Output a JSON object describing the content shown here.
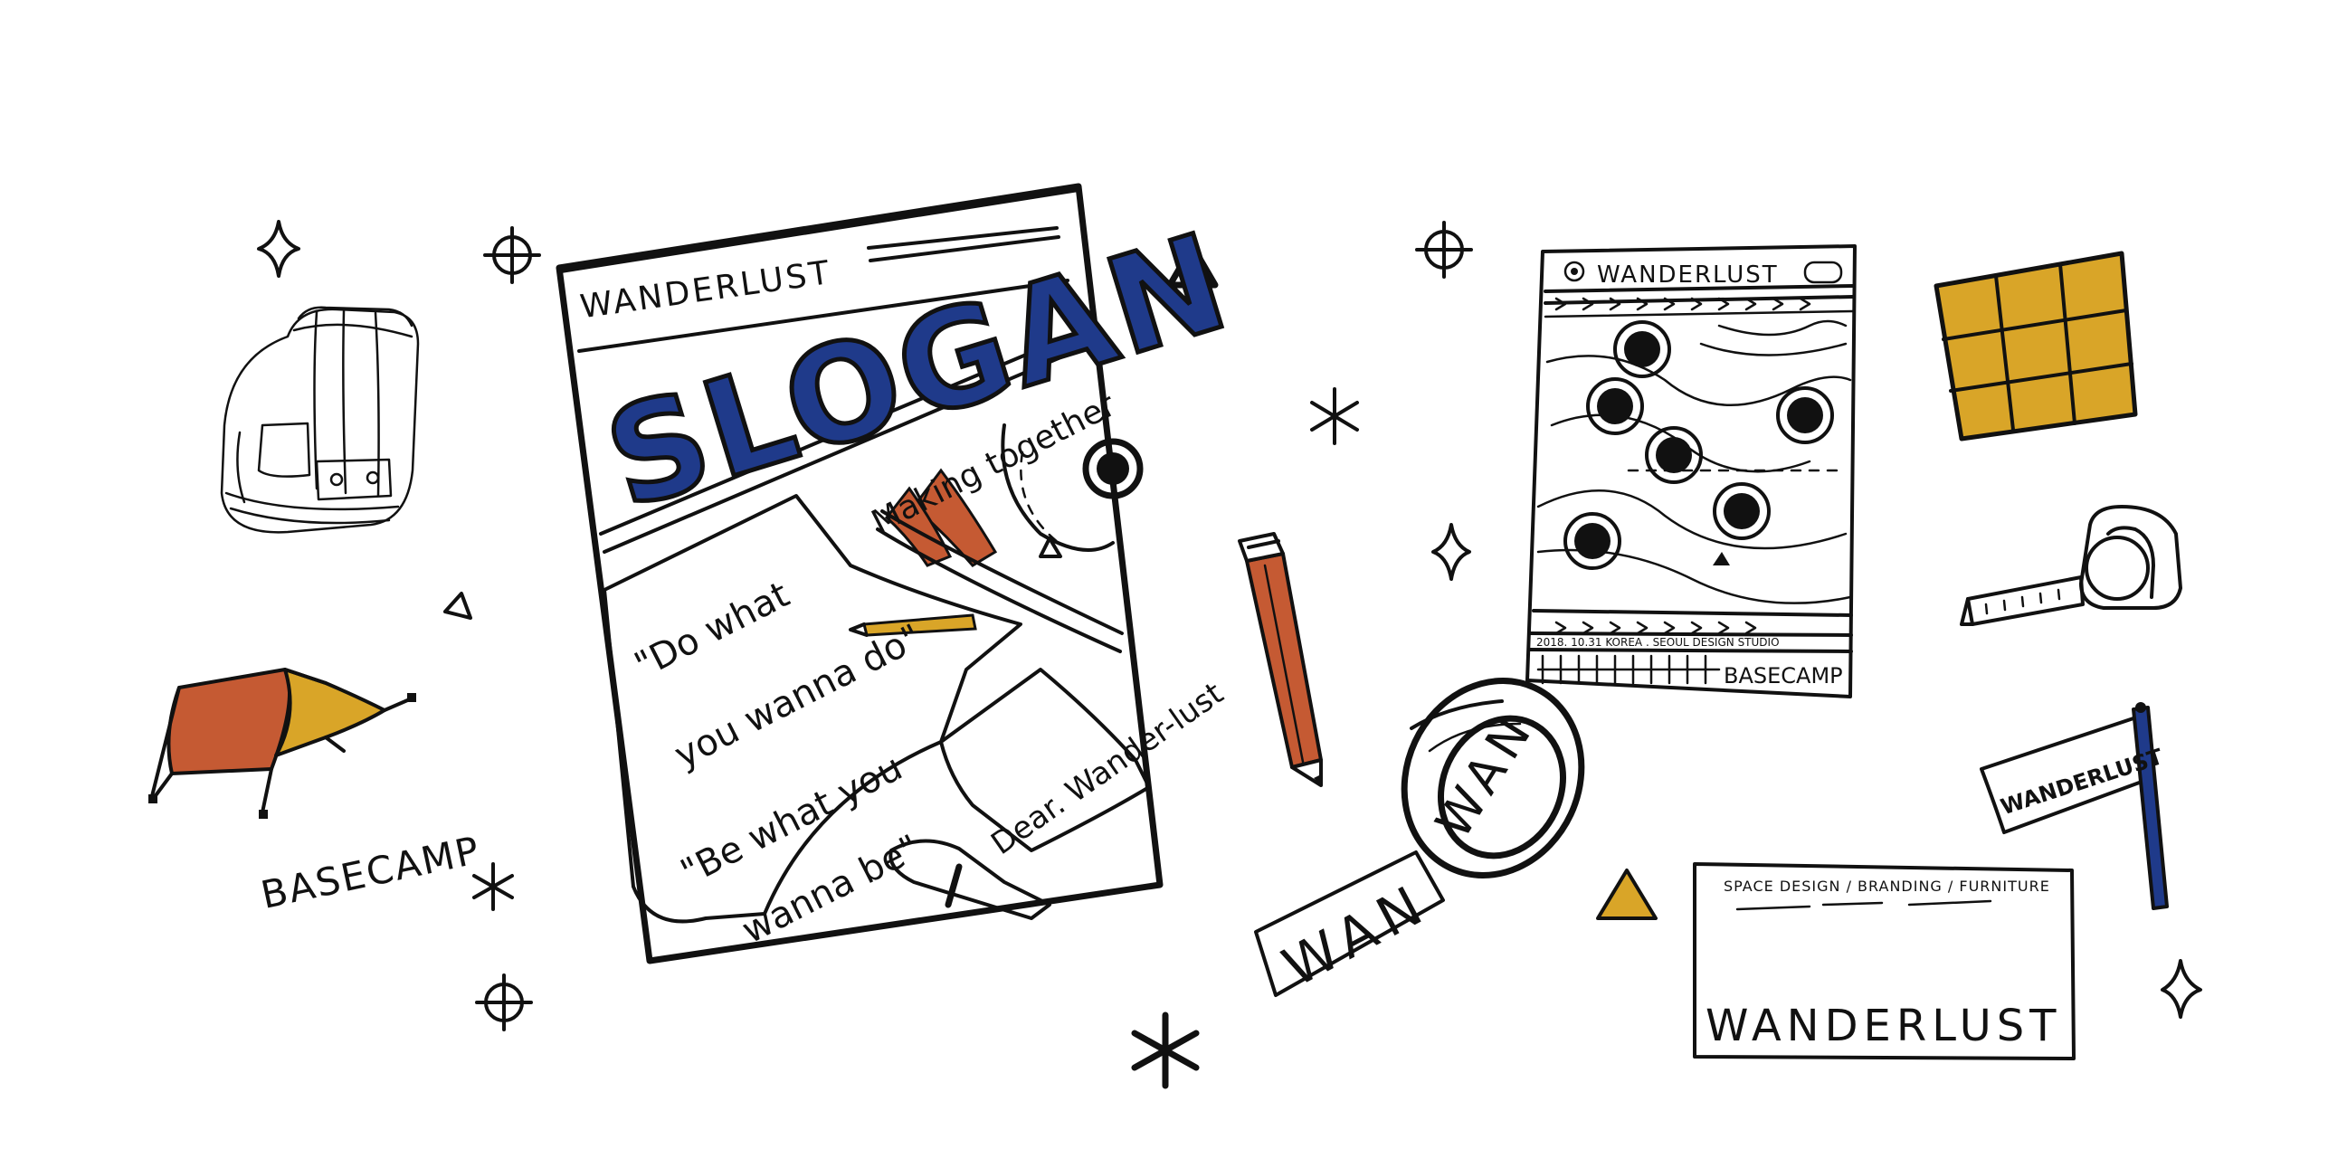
{
  "colors": {
    "ink": "#111111",
    "navy": "#1f3a8a",
    "rust": "#c55a33",
    "mustard": "#d9a528",
    "paper": "#ffffff"
  },
  "poster": {
    "brand": "WANDERLUST",
    "headline": "SLOGAN",
    "tagline": "Making together",
    "quote_line_1": "\"Do what",
    "quote_line_2": "you wanna do\"",
    "quote_line_3": "\"Be what you",
    "quote_line_4": "wanna be\"",
    "note": "Dear. Wander-lust"
  },
  "map_poster": {
    "brand": "WANDERLUST",
    "footer_info": "2018. 10.31 KOREA . SEOUL DESIGN STUDIO",
    "footer_tag": "BASECAMP"
  },
  "tent": {
    "label": "BASECAMP"
  },
  "tape": {
    "print": "WAN"
  },
  "flag": {
    "text": "WANDERLUST"
  },
  "business_card": {
    "services": "SPACE DESIGN / BRANDING / FURNITURE",
    "brand": "WANDERLUST"
  },
  "icons": [
    "backpack-icon",
    "tent-icon",
    "pencil-icon",
    "washi-tape-icon",
    "tape-measure-icon",
    "flag-icon",
    "sticky-notes-icon",
    "sparkle-icon",
    "crosshair-icon",
    "asterisk-icon",
    "triangle-icon"
  ]
}
